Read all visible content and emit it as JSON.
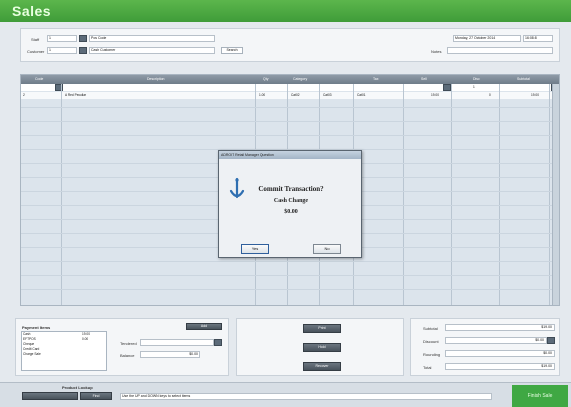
{
  "window": {
    "title": "Sales"
  },
  "header": {
    "staff_label": "Staff",
    "staff_code": "1",
    "staff_name": "Pos Code",
    "customer_label": "Customer",
    "customer_code": "1",
    "customer_name": "Cash Customer",
    "search_button": "Search",
    "date_value": "Monday, 27 October 2014",
    "time_value": "16:08:8",
    "notes_label": "Notes",
    "notes_value": ""
  },
  "grid": {
    "columns": [
      "Code",
      "Description",
      "Qty",
      "Category",
      "Cost",
      "Tax",
      "Sell",
      "Disc",
      "Subtotal"
    ],
    "new_row": {
      "qty": "1"
    },
    "rows": [
      {
        "code": "2",
        "description": "A Red Peculiar",
        "qty": "1.00",
        "category": "Cat02",
        "cost": "Cat03",
        "tax": "Cat01",
        "sell": "19.00",
        "disc": "0",
        "subtotal": "19.00"
      }
    ]
  },
  "dialog": {
    "title": "ADROIT Retail Manager Question",
    "line1": "Commit Transaction?",
    "line2": "Cash Change",
    "line3": "$0.00",
    "yes_button": "Yes",
    "no_button": "No",
    "icon": "help-icon"
  },
  "payment": {
    "section_label": "Payment Items",
    "add_button": "Add",
    "items": [
      {
        "name": "Cash",
        "amount": "19.00"
      },
      {
        "name": "EFTPOS",
        "amount": "0.00"
      },
      {
        "name": "Cheque",
        "amount": ""
      },
      {
        "name": "Credit Card",
        "amount": ""
      },
      {
        "name": "Charge Sale",
        "amount": ""
      }
    ],
    "tendered_label": "Tendered",
    "tendered_value": "",
    "balance_label": "Balance",
    "balance_value": "$0.00"
  },
  "actions": {
    "btn1": "Print",
    "btn2": "Hold",
    "btn3": "Recover"
  },
  "totals": {
    "subtotal_label": "Subtotal",
    "subtotal_value": "$19.00",
    "discount_label": "Discount",
    "discount_value": "$0.00",
    "rounding_label": "Rounding",
    "rounding_value": "$0.00",
    "total_label": "Total",
    "total_value": "$19.00"
  },
  "status": {
    "section_title": "Product Lookup",
    "lookup_value": "",
    "go_button": "Find",
    "message": "Use the UP and DOWN keys to select items",
    "finish_button": "Finish Sale"
  },
  "colors": {
    "title_green": "#46a23c",
    "finish_green": "#3fa843"
  }
}
